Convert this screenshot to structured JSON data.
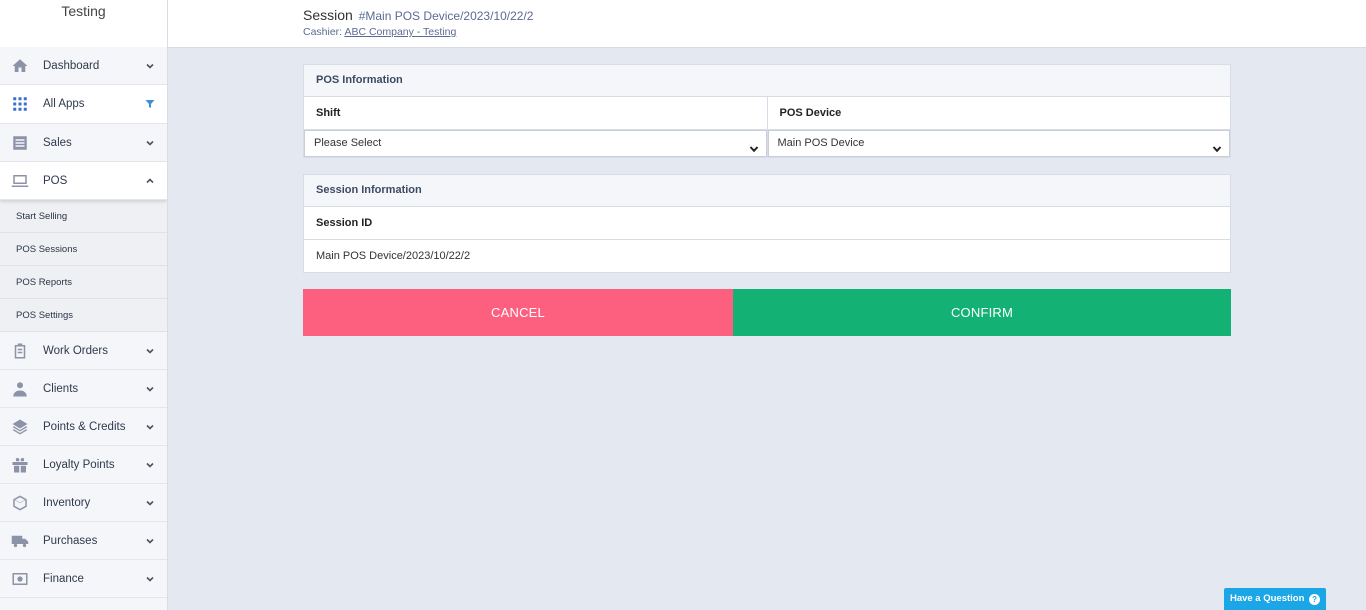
{
  "sidebar": {
    "brand": "Testing",
    "items": [
      {
        "label": "Dashboard",
        "icon": "home-icon",
        "indicator": "chevron-down"
      },
      {
        "label": "All Apps",
        "icon": "grid-icon",
        "indicator": "filter"
      },
      {
        "label": "Sales",
        "icon": "list-icon",
        "indicator": "chevron-down"
      },
      {
        "label": "POS",
        "icon": "pos-terminal-icon",
        "indicator": "chevron-up"
      },
      {
        "label": "Work Orders",
        "icon": "clipboard-icon",
        "indicator": "chevron-down"
      },
      {
        "label": "Clients",
        "icon": "user-icon",
        "indicator": "chevron-down"
      },
      {
        "label": "Points & Credits",
        "icon": "layers-icon",
        "indicator": "chevron-down"
      },
      {
        "label": "Loyalty Points",
        "icon": "gift-icon",
        "indicator": "chevron-down"
      },
      {
        "label": "Inventory",
        "icon": "box-icon",
        "indicator": "chevron-down"
      },
      {
        "label": "Purchases",
        "icon": "truck-icon",
        "indicator": "chevron-down"
      },
      {
        "label": "Finance",
        "icon": "safe-icon",
        "indicator": "chevron-down"
      }
    ],
    "pos_sub": [
      "Start Selling",
      "POS Sessions",
      "POS Reports",
      "POS Settings"
    ]
  },
  "header": {
    "title": "Session",
    "session_number": "#Main POS Device/2023/10/22/2",
    "cashier_label": "Cashier:",
    "cashier_name": "ABC Company - Testing"
  },
  "pos_info": {
    "heading": "POS Information",
    "shift_label": "Shift",
    "shift_value": "Please Select",
    "device_label": "POS Device",
    "device_value": "Main POS Device"
  },
  "session_info": {
    "heading": "Session Information",
    "id_label": "Session ID",
    "id_value": "Main POS Device/2023/10/22/2"
  },
  "actions": {
    "cancel": "CANCEL",
    "confirm": "CONFIRM"
  },
  "help": {
    "label": "Have a Question",
    "icon": "question-icon"
  },
  "colors": {
    "cancel": "#fd5f7f",
    "confirm": "#13b274",
    "help": "#1ba7e7",
    "accent_text": "#5c6a94"
  }
}
